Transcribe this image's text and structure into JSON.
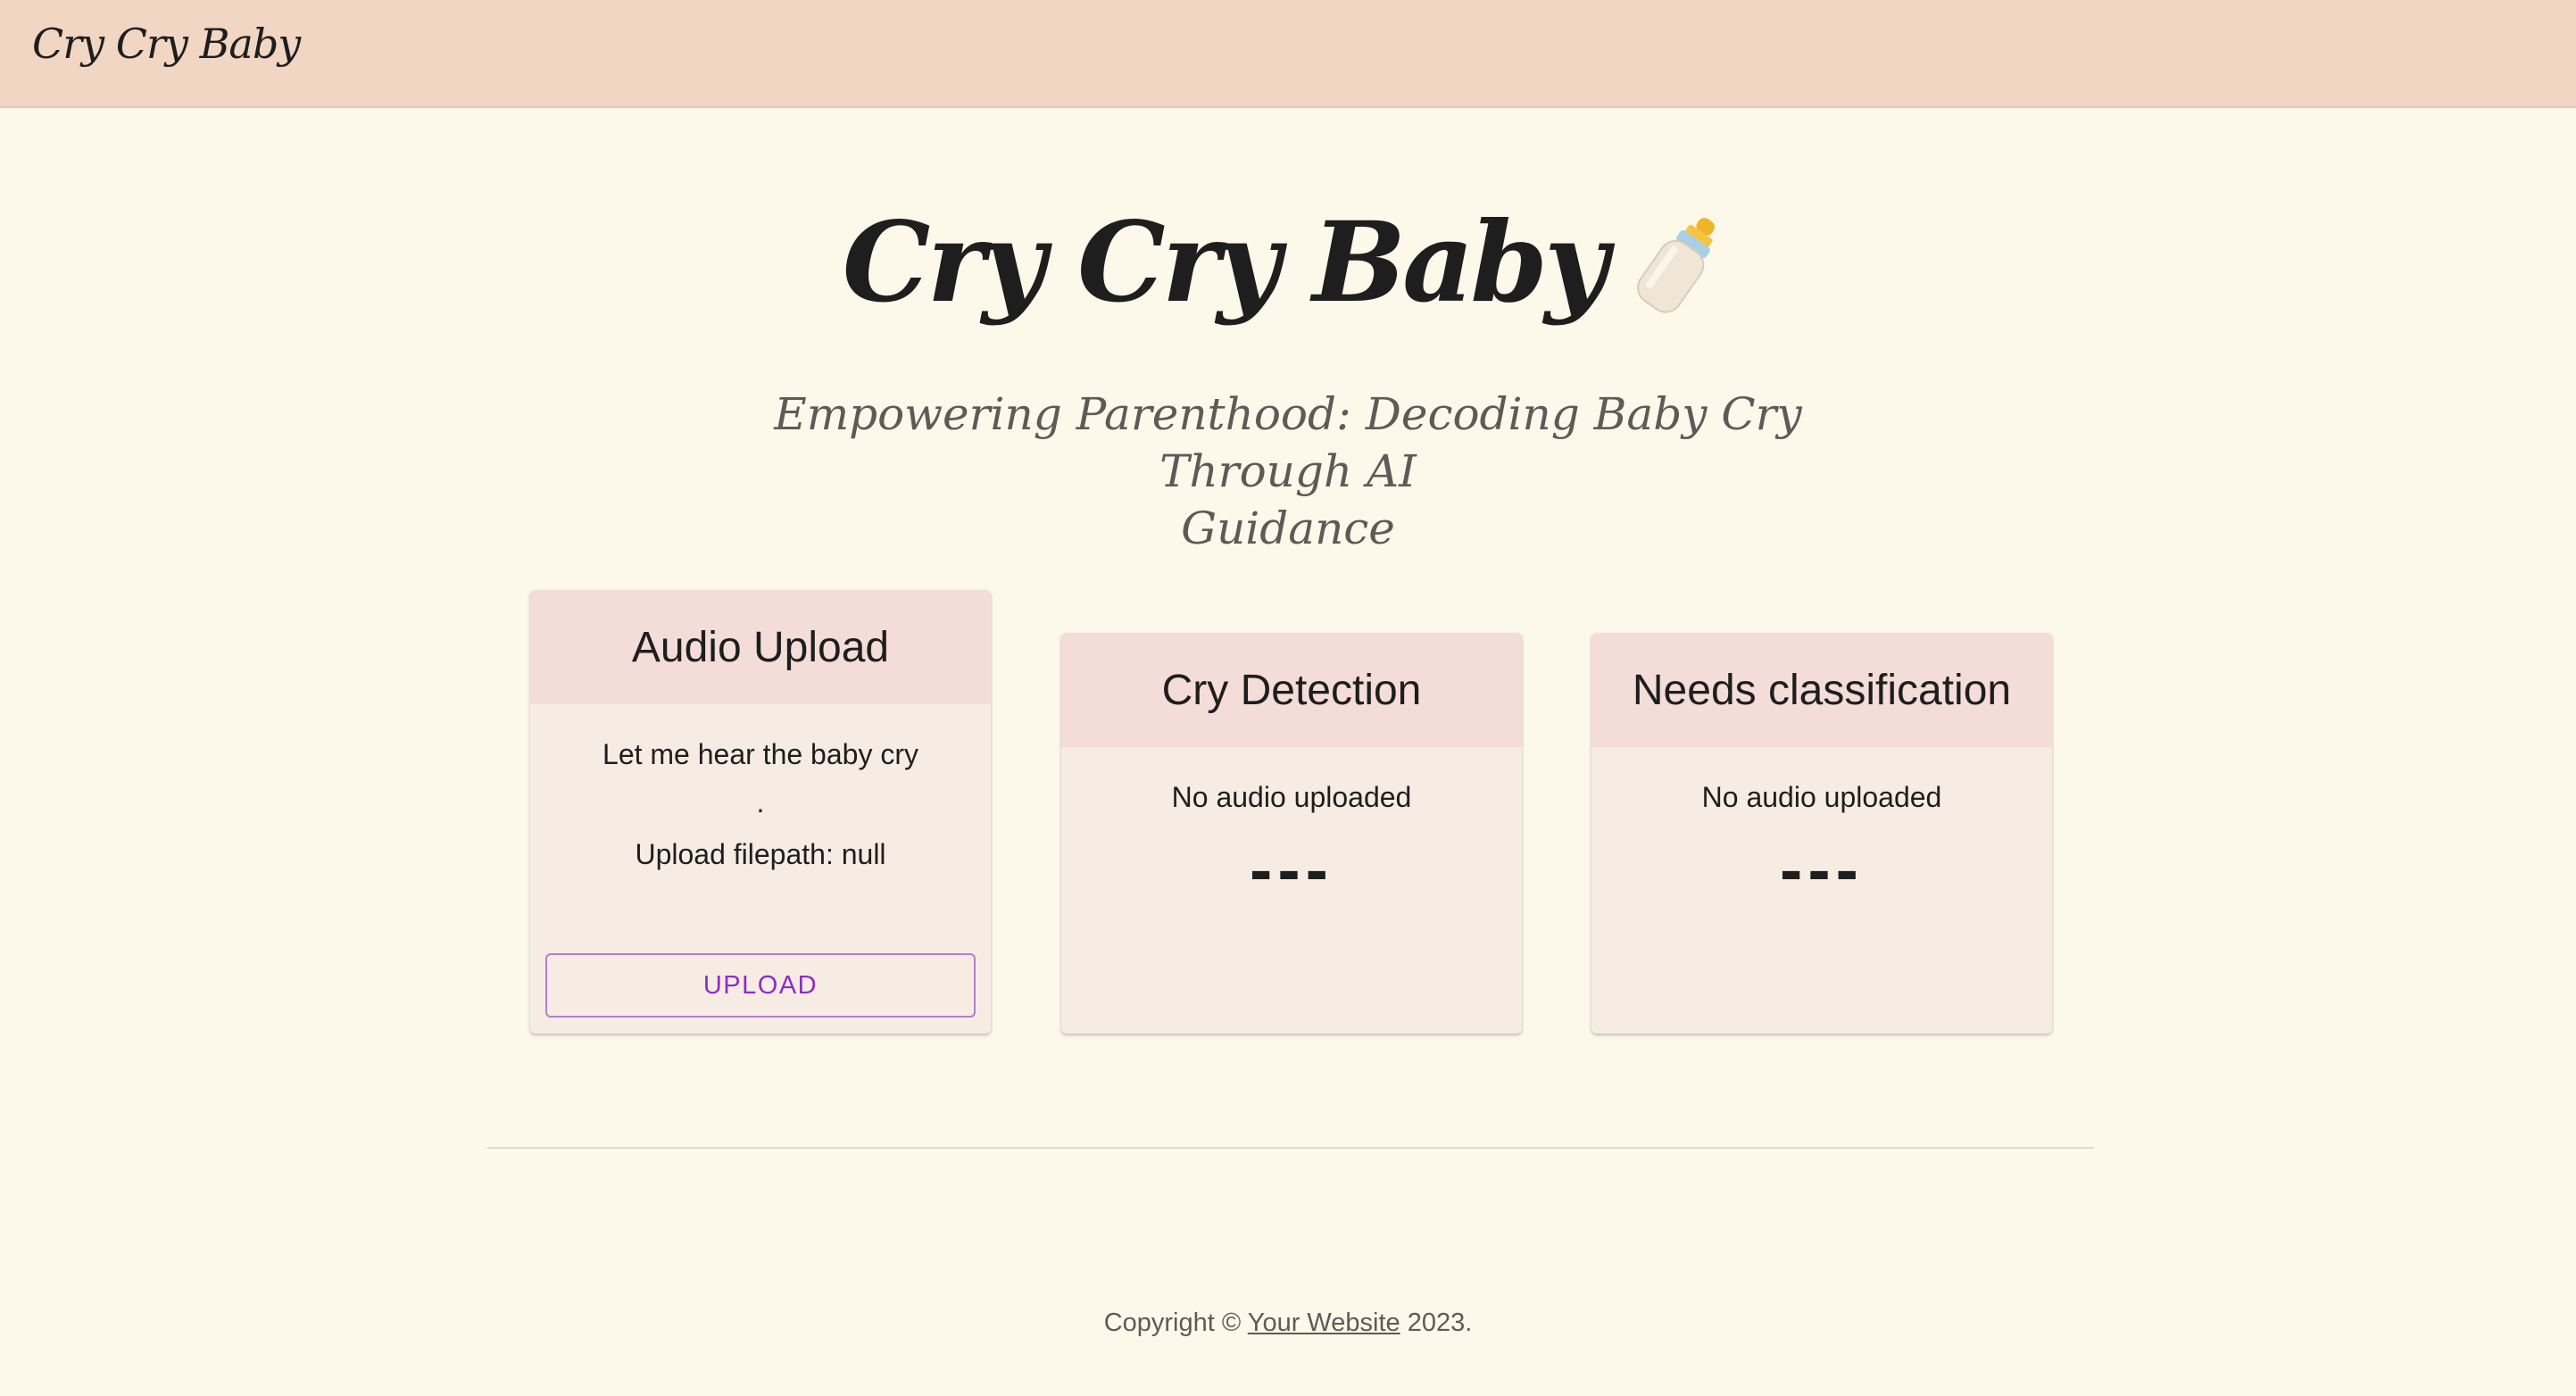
{
  "nav": {
    "brand": "Cry Cry Baby"
  },
  "hero": {
    "title": "Cry Cry Baby",
    "icon": "baby-bottle-icon",
    "subtitle_line1": "Empowering Parenthood: Decoding Baby Cry Through AI",
    "subtitle_line2": "Guidance"
  },
  "cards": {
    "upload": {
      "title": "Audio Upload",
      "prompt": "Let me hear the baby cry",
      "dot": ".",
      "filepath": "Upload filepath: null",
      "button_label": "UPLOAD"
    },
    "detection": {
      "title": "Cry Detection",
      "status": "No audio uploaded",
      "result": "---"
    },
    "classification": {
      "title": "Needs classification",
      "status": "No audio uploaded",
      "result": "---"
    }
  },
  "footer": {
    "prefix": "Copyright © ",
    "link_text": "Your Website",
    "suffix": " 2023."
  },
  "colors": {
    "page_bg": "#fdf9ea",
    "topbar_bg": "#f1d6c4",
    "card_bg": "#f7ece3",
    "card_header_bg": "#f4ddd8",
    "button_accent": "#8a2ec8"
  }
}
